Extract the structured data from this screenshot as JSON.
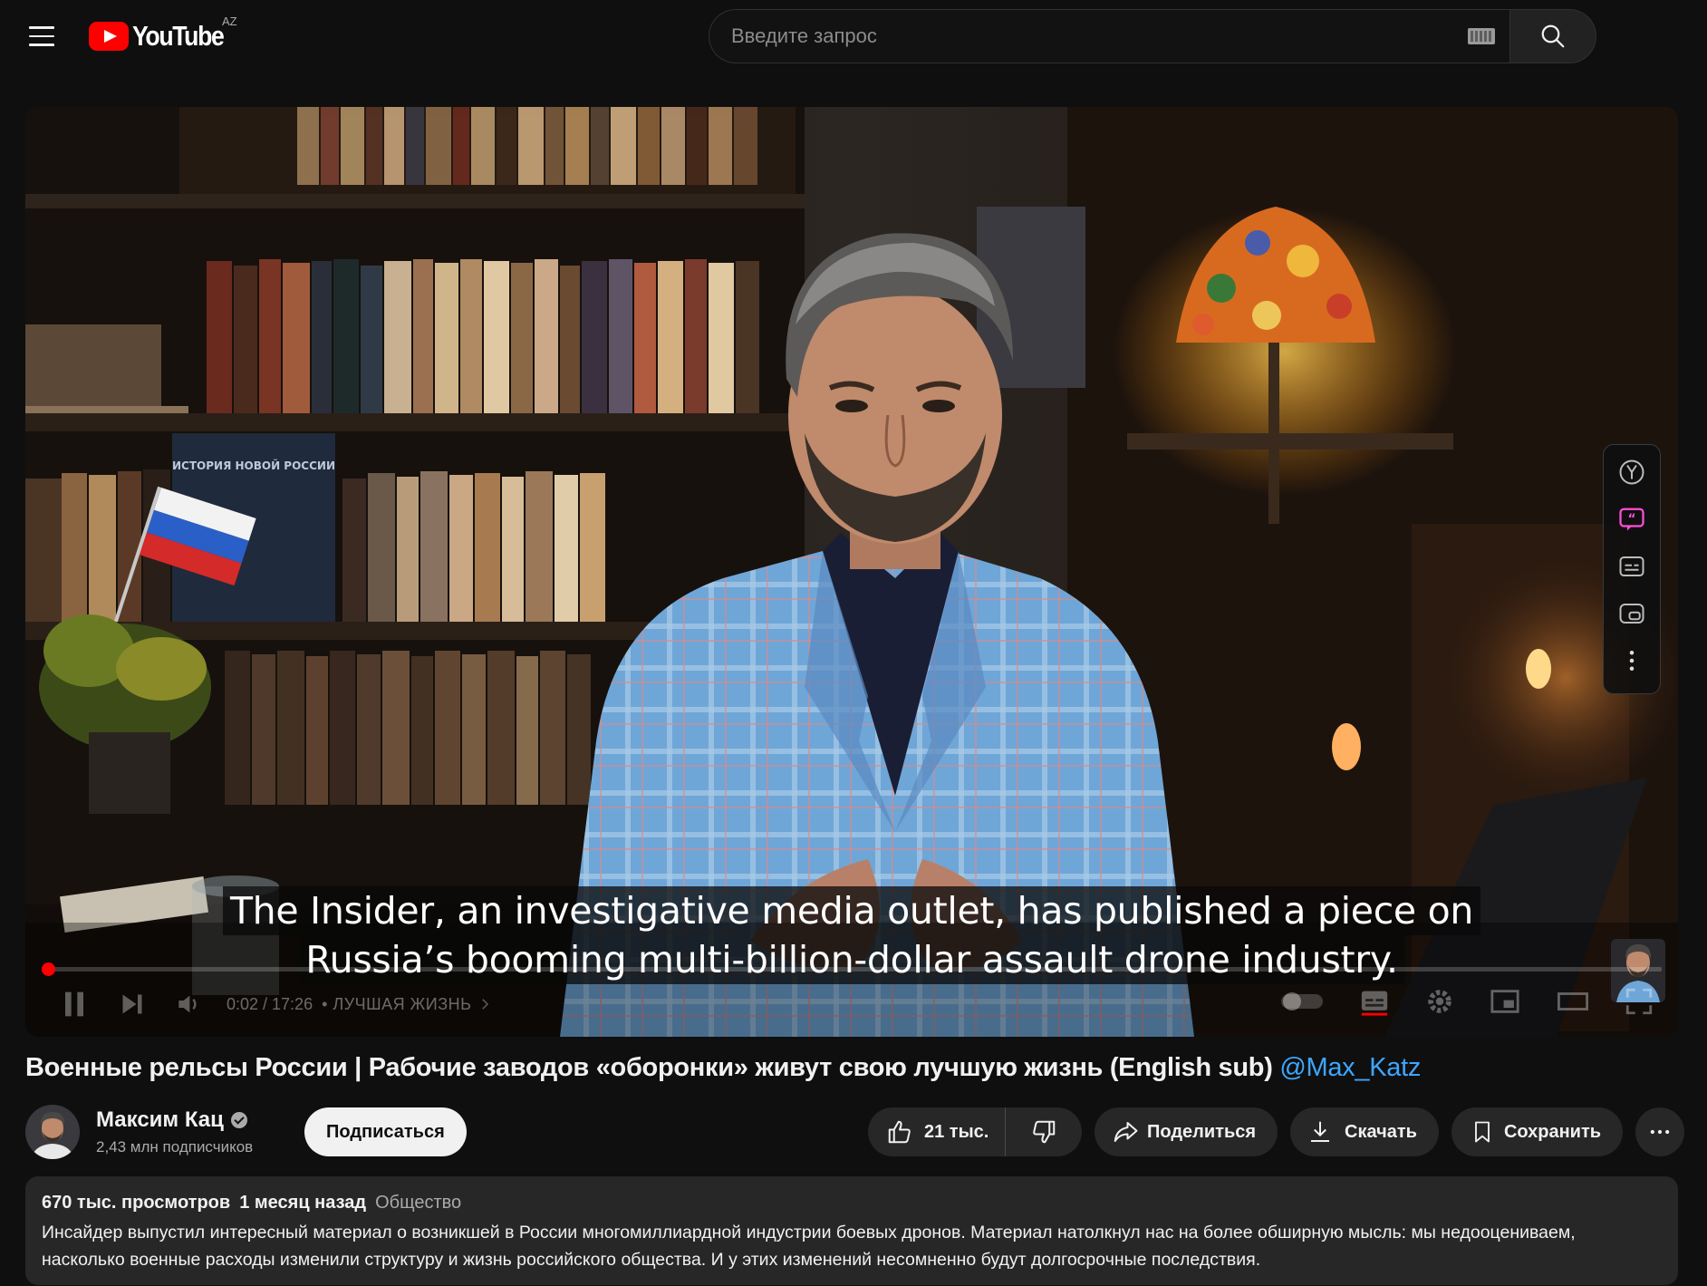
{
  "header": {
    "logo_text": "YouTube",
    "region": "AZ",
    "search_placeholder": "Введите запрос"
  },
  "player": {
    "captions": [
      "The Insider, an investigative media outlet, has published a piece on",
      "Russia’s booming multi-billion-dollar assault drone industry."
    ],
    "time": "0:02 / 17:26",
    "chapter": "• ЛУЧШАЯ ЖИЗНЬ",
    "progress_fraction": 0.002,
    "book_title": "ИСТОРИЯ НОВОЙ РОССИИ",
    "side_panel_icons": [
      "yandex-browser-icon",
      "quote-icon",
      "subtitles-icon",
      "picture-in-picture-icon",
      "more-vertical-icon"
    ]
  },
  "video": {
    "title": "Военные рельсы России | Рабочие заводов «оборонки» живут свою лучшую жизнь (English sub)",
    "title_mention": "@Max_Katz"
  },
  "channel": {
    "name": "Максим Кац",
    "subscribers": "2,43 млн подписчиков",
    "subscribe_label": "Подписаться"
  },
  "actions": {
    "likes": "21 тыс.",
    "share": "Поделиться",
    "download": "Скачать",
    "save": "Сохранить"
  },
  "description": {
    "views": "670 тыс. просмотров",
    "date": "1 месяц назад",
    "category": "Общество",
    "text": "Инсайдер выпустил интересный материал о возникшей в России многомиллиардной индустрии боевых дронов. Материал натолкнул нас на более обширную мысль: мы недооцениваем, насколько военные расходы изменили структуру и жизнь российского общества. И у этих изменений несомненно будут долгосрочные последствия."
  },
  "colors": {
    "background": "#0f0f0f",
    "accent_red": "#ff0000",
    "link_blue": "#3ea6ff",
    "pill": "#272727",
    "quote_icon": "#ff4fd8"
  }
}
